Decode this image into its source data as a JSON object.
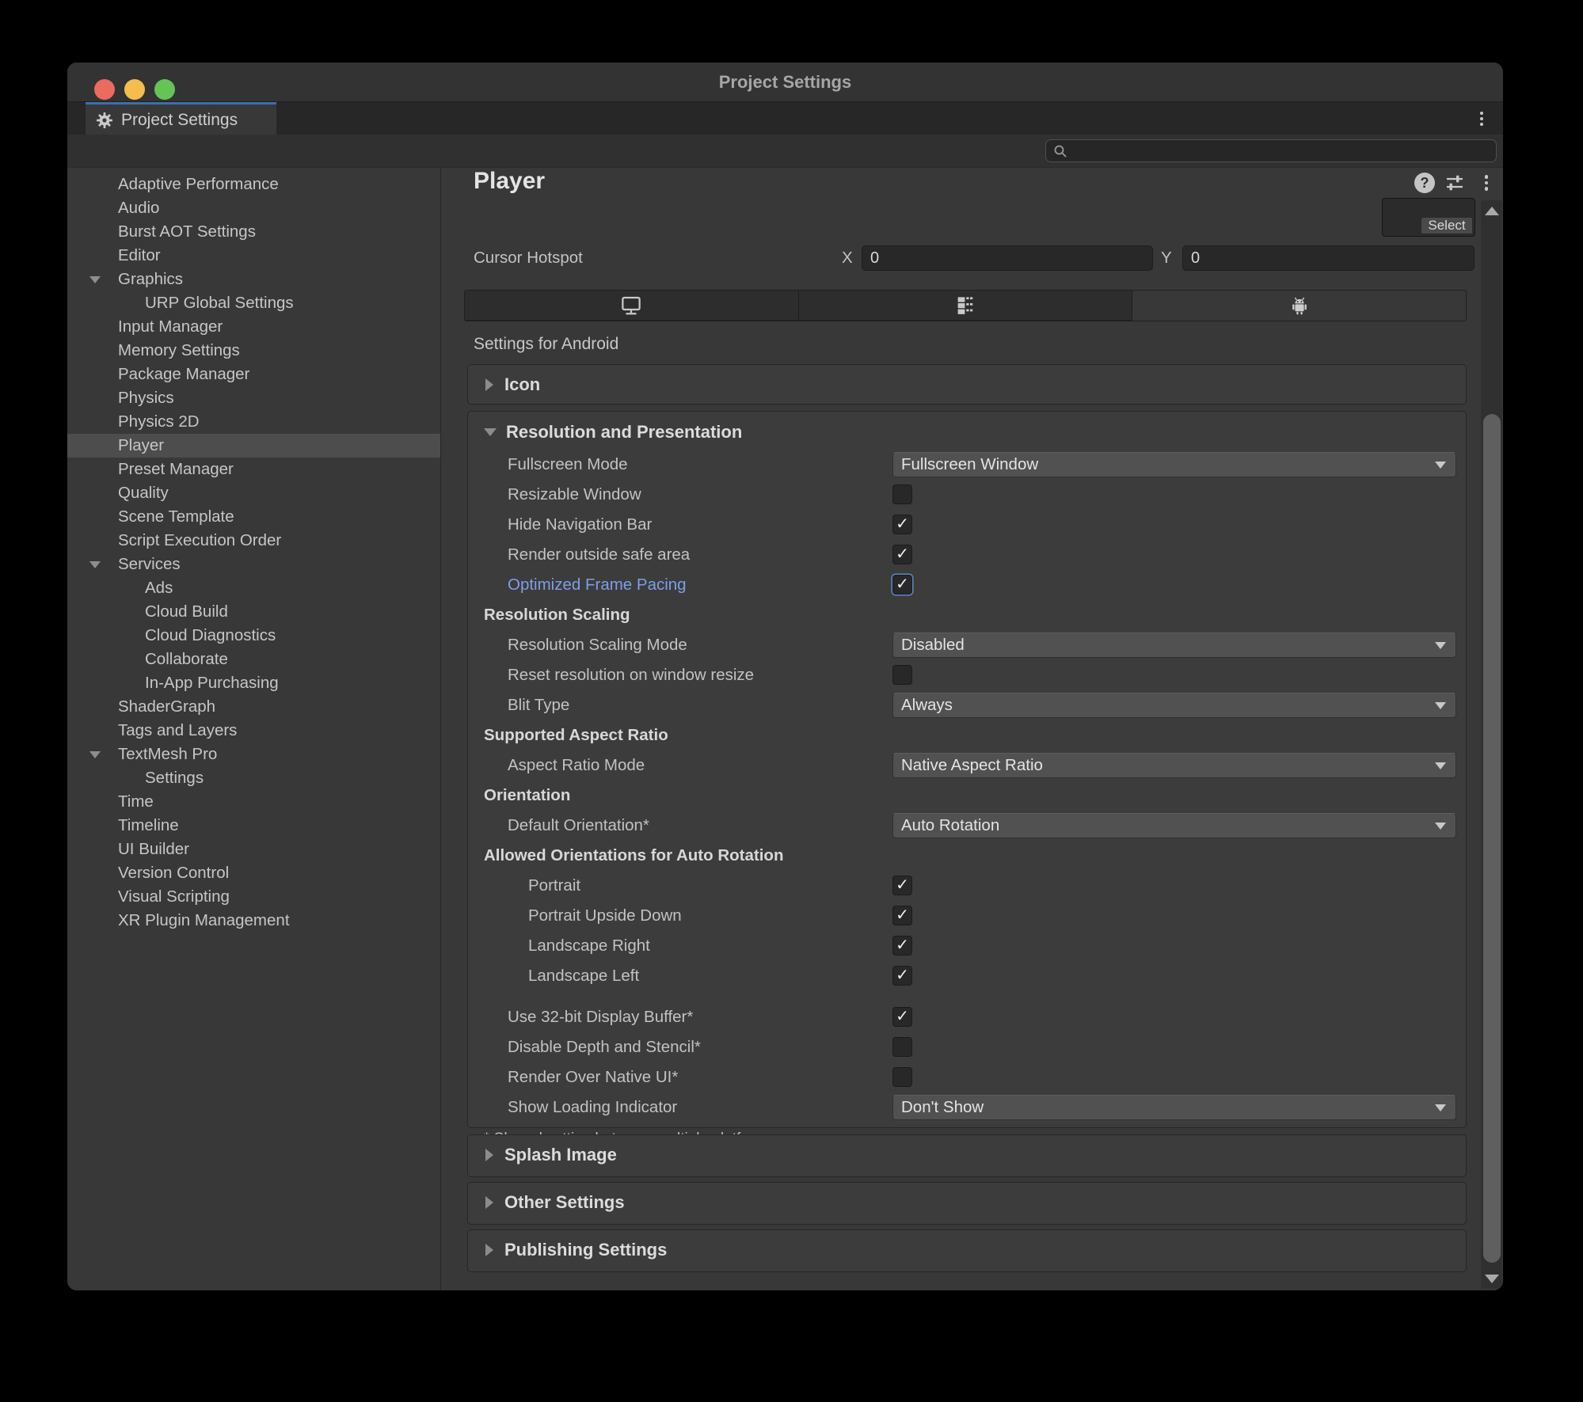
{
  "window": {
    "title": "Project Settings"
  },
  "tabbar": {
    "tab_label": "Project Settings"
  },
  "search": {
    "placeholder": ""
  },
  "sidebar": {
    "items": [
      {
        "label": "Adaptive Performance",
        "indent": 0
      },
      {
        "label": "Audio",
        "indent": 0
      },
      {
        "label": "Burst AOT Settings",
        "indent": 0
      },
      {
        "label": "Editor",
        "indent": 0
      },
      {
        "label": "Graphics",
        "indent": 0,
        "expanded": true
      },
      {
        "label": "URP Global Settings",
        "indent": 1
      },
      {
        "label": "Input Manager",
        "indent": 0
      },
      {
        "label": "Memory Settings",
        "indent": 0
      },
      {
        "label": "Package Manager",
        "indent": 0
      },
      {
        "label": "Physics",
        "indent": 0
      },
      {
        "label": "Physics 2D",
        "indent": 0
      },
      {
        "label": "Player",
        "indent": 0,
        "selected": true
      },
      {
        "label": "Preset Manager",
        "indent": 0
      },
      {
        "label": "Quality",
        "indent": 0
      },
      {
        "label": "Scene Template",
        "indent": 0
      },
      {
        "label": "Script Execution Order",
        "indent": 0
      },
      {
        "label": "Services",
        "indent": 0,
        "expanded": true
      },
      {
        "label": "Ads",
        "indent": 1
      },
      {
        "label": "Cloud Build",
        "indent": 1
      },
      {
        "label": "Cloud Diagnostics",
        "indent": 1
      },
      {
        "label": "Collaborate",
        "indent": 1
      },
      {
        "label": "In-App Purchasing",
        "indent": 1
      },
      {
        "label": "ShaderGraph",
        "indent": 0
      },
      {
        "label": "Tags and Layers",
        "indent": 0
      },
      {
        "label": "TextMesh Pro",
        "indent": 0,
        "expanded": true
      },
      {
        "label": "Settings",
        "indent": 1
      },
      {
        "label": "Time",
        "indent": 0
      },
      {
        "label": "Timeline",
        "indent": 0
      },
      {
        "label": "UI Builder",
        "indent": 0
      },
      {
        "label": "Version Control",
        "indent": 0
      },
      {
        "label": "Visual Scripting",
        "indent": 0
      },
      {
        "label": "XR Plugin Management",
        "indent": 0
      }
    ]
  },
  "player": {
    "title": "Player",
    "header_icons": [
      "help-icon",
      "presets-icon",
      "kebab-menu-icon"
    ],
    "select_button": "Select",
    "cursor_hotspot": {
      "label": "Cursor Hotspot",
      "x_label": "X",
      "x_value": "0",
      "y_label": "Y",
      "y_value": "0"
    },
    "platform_tabs": [
      {
        "icon": "desktop-monitor",
        "selected": false
      },
      {
        "icon": "dedicated-server",
        "selected": false
      },
      {
        "icon": "android",
        "selected": true
      }
    ],
    "settings_for": "Settings for Android",
    "sections": {
      "icon": {
        "label": "Icon",
        "collapsed": true
      },
      "resolution_presentation": {
        "label": "Resolution and Presentation",
        "collapsed": false,
        "rows": [
          {
            "type": "dropdown",
            "label": "Fullscreen Mode",
            "indent": 1,
            "value": "Fullscreen Window"
          },
          {
            "type": "checkbox",
            "label": "Resizable Window",
            "indent": 1,
            "checked": false
          },
          {
            "type": "checkbox",
            "label": "Hide Navigation Bar",
            "indent": 1,
            "checked": true
          },
          {
            "type": "checkbox",
            "label": "Render outside safe area",
            "indent": 1,
            "checked": true
          },
          {
            "type": "checkbox",
            "label": "Optimized Frame Pacing",
            "indent": 1,
            "checked": true,
            "accent": true
          },
          {
            "type": "subheader",
            "label": "Resolution Scaling",
            "indent": 0
          },
          {
            "type": "dropdown",
            "label": "Resolution Scaling Mode",
            "indent": 1,
            "value": "Disabled"
          },
          {
            "type": "checkbox",
            "label": "Reset resolution on window resize",
            "indent": 1,
            "checked": false
          },
          {
            "type": "dropdown",
            "label": "Blit Type",
            "indent": 1,
            "value": "Always"
          },
          {
            "type": "subheader",
            "label": "Supported Aspect Ratio",
            "indent": 0
          },
          {
            "type": "dropdown",
            "label": "Aspect Ratio Mode",
            "indent": 1,
            "value": "Native Aspect Ratio"
          },
          {
            "type": "subheader",
            "label": "Orientation",
            "indent": 0
          },
          {
            "type": "dropdown",
            "label": "Default Orientation*",
            "indent": 1,
            "value": "Auto Rotation"
          },
          {
            "type": "subheader",
            "label": "Allowed Orientations for Auto Rotation",
            "indent": 0
          },
          {
            "type": "checkbox",
            "label": "Portrait",
            "indent": 2,
            "checked": true
          },
          {
            "type": "checkbox",
            "label": "Portrait Upside Down",
            "indent": 2,
            "checked": true
          },
          {
            "type": "checkbox",
            "label": "Landscape Right",
            "indent": 2,
            "checked": true
          },
          {
            "type": "checkbox",
            "label": "Landscape Left",
            "indent": 2,
            "checked": true
          },
          {
            "type": "checkbox",
            "label": "Use 32-bit Display Buffer*",
            "indent": 1,
            "checked": true,
            "gap_before": true
          },
          {
            "type": "checkbox",
            "label": "Disable Depth and Stencil*",
            "indent": 1,
            "checked": false
          },
          {
            "type": "checkbox",
            "label": "Render Over Native UI*",
            "indent": 1,
            "checked": false
          },
          {
            "type": "dropdown",
            "label": "Show Loading Indicator",
            "indent": 1,
            "value": "Don't Show"
          }
        ],
        "note": "* Shared setting between multiple platforms."
      },
      "splash": {
        "label": "Splash Image",
        "collapsed": true
      },
      "other": {
        "label": "Other Settings",
        "collapsed": true
      },
      "publishing": {
        "label": "Publishing Settings",
        "collapsed": true
      }
    }
  },
  "colors": {
    "window_bg": "#383838",
    "titlebar_bg": "#333333",
    "tabbar_bg": "#272727",
    "active_tab_accent": "#3a70ae",
    "selected_row_bg": "#4d4d4d",
    "field_bg": "#282828",
    "dropdown_bg": "#515151",
    "accent_label": "#7c9fe6",
    "traffic_red": "#ec6a5e",
    "traffic_yellow": "#f5bd4f",
    "traffic_green": "#62c554"
  }
}
